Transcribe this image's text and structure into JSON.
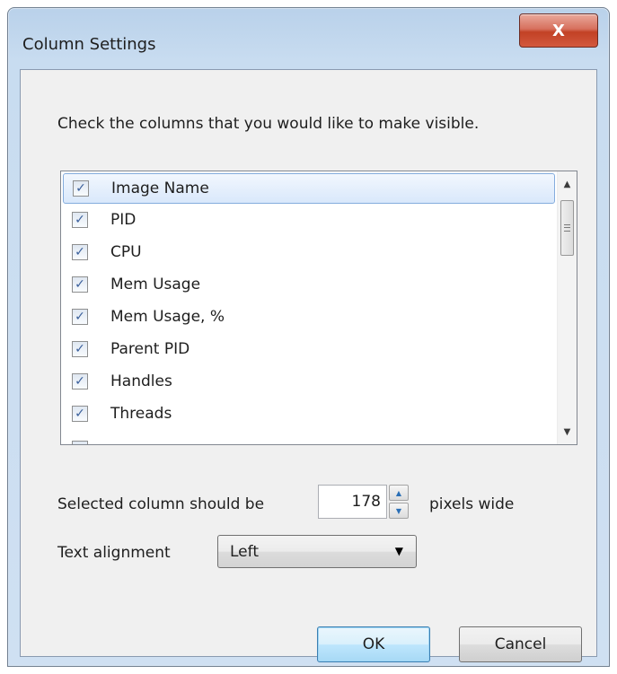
{
  "window": {
    "title": "Column Settings",
    "close_label": "X"
  },
  "instructions": "Check the columns that you would like to make visible.",
  "columns": [
    {
      "label": "Image Name",
      "checked": true,
      "selected": true
    },
    {
      "label": "PID",
      "checked": true,
      "selected": false
    },
    {
      "label": "CPU",
      "checked": true,
      "selected": false
    },
    {
      "label": "Mem Usage",
      "checked": true,
      "selected": false
    },
    {
      "label": "Mem Usage, %",
      "checked": true,
      "selected": false
    },
    {
      "label": "Parent PID",
      "checked": true,
      "selected": false
    },
    {
      "label": "Handles",
      "checked": true,
      "selected": false
    },
    {
      "label": "Threads",
      "checked": true,
      "selected": false
    }
  ],
  "check_glyph": "✓",
  "width_setting": {
    "label": "Selected column should be",
    "value": "178",
    "suffix": "pixels wide"
  },
  "alignment": {
    "label": "Text alignment",
    "value": "Left"
  },
  "buttons": {
    "ok": "OK",
    "cancel": "Cancel"
  },
  "icons": {
    "close": "close-icon",
    "scroll_up": "scroll-up-arrow-icon",
    "scroll_down": "scroll-down-arrow-icon",
    "spin_up": "spin-up-icon",
    "spin_down": "spin-down-icon",
    "dropdown": "chevron-down-icon"
  },
  "colors": {
    "close_button": "#c24125",
    "selection_border": "#84acdd",
    "default_button_border": "#3c7fb1"
  }
}
